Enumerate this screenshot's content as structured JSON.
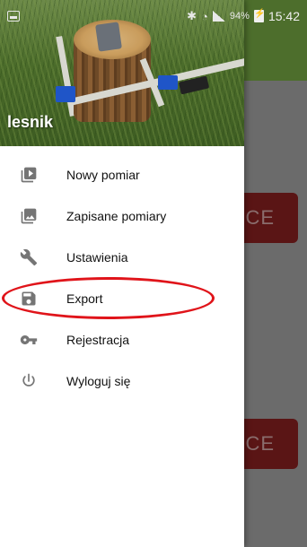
{
  "status_bar": {
    "battery_percent": "94%",
    "time": "15:42"
  },
  "drawer": {
    "header": {
      "username": "lesnik"
    },
    "menu": [
      {
        "label": "Nowy pomiar",
        "icon": "play-box-icon"
      },
      {
        "label": "Zapisane pomiary",
        "icon": "image-gallery-icon"
      },
      {
        "label": "Ustawienia",
        "icon": "wrench-icon"
      },
      {
        "label": "Export",
        "icon": "save-icon"
      },
      {
        "label": "Rejestracja",
        "icon": "key-icon"
      },
      {
        "label": "Wyloguj się",
        "icon": "power-icon"
      }
    ]
  },
  "background": {
    "button_1_text": "CE",
    "button_2_text": "CE"
  },
  "colors": {
    "toolbar": "#4d6e2c",
    "accent_button": "#5a1515",
    "highlight": "#e0141a",
    "icon": "#757575"
  }
}
